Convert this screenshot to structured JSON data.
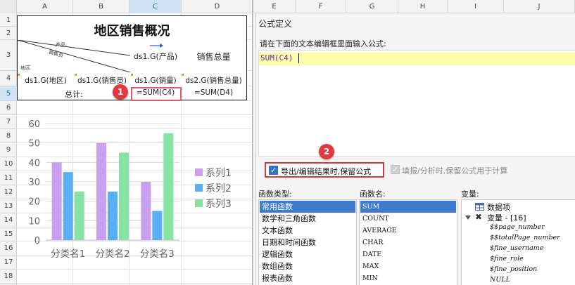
{
  "sheet": {
    "columns": [
      "A",
      "B",
      "C",
      "D",
      "E",
      "F",
      "G",
      "H",
      "I",
      "J"
    ],
    "rows": [
      "1",
      "2",
      "3",
      "4",
      "5",
      "6",
      "7",
      "8",
      "9",
      "10",
      "11",
      "12",
      "13",
      "14",
      "15",
      "16",
      "17",
      "18",
      "19"
    ],
    "selected_column": "C",
    "selected_row": "5"
  },
  "report": {
    "title": "地区销售概况",
    "header_diag": {
      "top": "产品",
      "middle": "销售员",
      "bottom": "地区"
    },
    "header_c3": "ds1.G(产品)",
    "header_d3": "销售总量",
    "row4": [
      "ds1.G(地区)",
      "ds1.G(销售员)",
      "ds1.G(销量)",
      "ds2.G(销售总量)"
    ],
    "row5_label": "总计:",
    "row5_c": "=SUM(C4)",
    "row5_d": "=SUM(D4)"
  },
  "badges": {
    "one": "1",
    "two": "2"
  },
  "chart_data": {
    "type": "bar",
    "categories": [
      "分类名1",
      "分类名2",
      "分类名3"
    ],
    "series": [
      {
        "name": "系列1",
        "values": [
          40,
          50,
          30
        ],
        "color": "#c9a0f0"
      },
      {
        "name": "系列2",
        "values": [
          35,
          25,
          15
        ],
        "color": "#5aaef2"
      },
      {
        "name": "系列3",
        "values": [
          25,
          45,
          55
        ],
        "color": "#86e3a4"
      }
    ],
    "ylim": [
      0,
      60
    ],
    "yticks": [
      "0",
      "10",
      "20",
      "30",
      "40",
      "50",
      "60"
    ],
    "grid": true,
    "legend_position": "right"
  },
  "dialog": {
    "title": "公式定义",
    "prompt": "请在下面的文本编辑框里面输入公式:",
    "formula": "SUM(C4)",
    "export_option": {
      "label": "导出/编辑结果时,保留公式",
      "checked": true
    },
    "fill_option": {
      "label": "填报/分析时,保留公式用于计算",
      "checked": true,
      "enabled": false
    },
    "func_type_label": "函数类型:",
    "func_types": [
      "常用函数",
      "数学和三角函数",
      "文本函数",
      "日期和时间函数",
      "逻辑函数",
      "数组函数",
      "报表函数"
    ],
    "selected_func_type": "常用函数",
    "func_name_label": "函数名:",
    "func_names": [
      "SUM",
      "COUNT",
      "AVERAGE",
      "CHAR",
      "DATE",
      "MAX",
      "MIN"
    ],
    "selected_func_name": "SUM",
    "var_label": "变量:",
    "tree": {
      "data_item": "数据项",
      "variables_group": "变量 - [16]",
      "variables": [
        "$$page_number",
        "$$totalPage_number",
        "$fine_username",
        "$fine_role",
        "$fine_position",
        "NULL"
      ]
    }
  },
  "icons": {
    "checkbox": "check-icon",
    "expand": "chevron-down-icon",
    "data": "table-icon",
    "vars": "variable-icon"
  }
}
